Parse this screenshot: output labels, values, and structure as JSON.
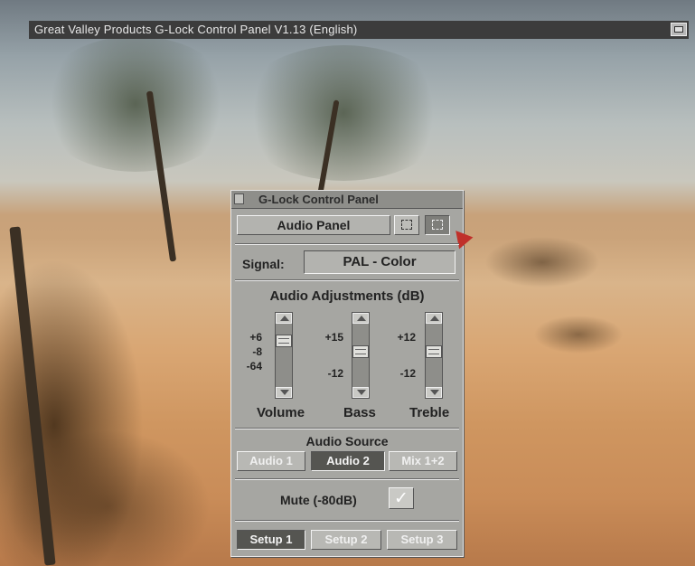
{
  "screen": {
    "title": "Great Valley Products G-Lock Control Panel V1.13 (English)",
    "depth_gadget_icon": "depth-arrange-icon"
  },
  "panel": {
    "title": "G-Lock Control Panel",
    "close_icon": "close-gadget-icon",
    "mode_label": "Audio Panel",
    "mode_buttons": [
      {
        "icon": "video-panel-icon",
        "active": false
      },
      {
        "icon": "audio-panel-icon",
        "active": true
      }
    ],
    "signal": {
      "label": "Signal:",
      "value": "PAL - Color"
    },
    "adjustments": {
      "title": "Audio Adjustments (dB)",
      "sliders": [
        {
          "label": "Volume",
          "scale": [
            "+6",
            "-8",
            "-64"
          ],
          "level": 0.78
        },
        {
          "label": "Bass",
          "scale": [
            "+15",
            "-12"
          ],
          "level": 0.55
        },
        {
          "label": "Treble",
          "scale": [
            "+12",
            "-12"
          ],
          "level": 0.55
        }
      ]
    },
    "source": {
      "title": "Audio Source",
      "options": [
        {
          "label": "Audio 1",
          "selected": false
        },
        {
          "label": "Audio 2",
          "selected": true
        },
        {
          "label": "Mix 1+2",
          "selected": false
        }
      ]
    },
    "mute": {
      "label": "Mute (-80dB)",
      "checked": true
    },
    "setups": [
      {
        "label": "Setup 1",
        "selected": true
      },
      {
        "label": "Setup 2",
        "selected": false
      },
      {
        "label": "Setup 3",
        "selected": false
      }
    ]
  }
}
